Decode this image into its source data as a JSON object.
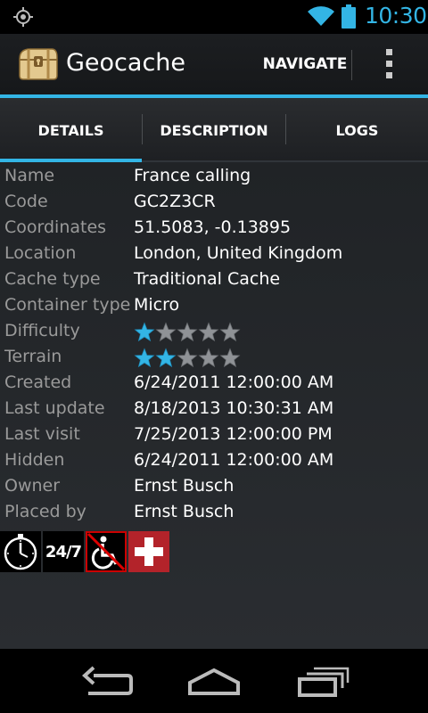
{
  "status_bar": {
    "time": "10:30",
    "icons": [
      "gps-icon",
      "wifi-icon",
      "battery-icon"
    ],
    "accent_color": "#33b5e5"
  },
  "action_bar": {
    "title": "Geocache",
    "navigate_label": "NAVIGATE",
    "logo_icon": "treasure-chest-icon",
    "overflow_icon": "overflow-menu-icon"
  },
  "tabs": [
    {
      "label": "DETAILS",
      "selected": true
    },
    {
      "label": "DESCRIPTION",
      "selected": false
    },
    {
      "label": "LOGS",
      "selected": false
    }
  ],
  "details": [
    {
      "label": "Name",
      "value": "France calling"
    },
    {
      "label": "Code",
      "value": "GC2Z3CR"
    },
    {
      "label": "Coordinates",
      "value": "51.5083, -0.13895"
    },
    {
      "label": "Location",
      "value": "London, United Kingdom"
    },
    {
      "label": "Cache type",
      "value": "Traditional Cache"
    },
    {
      "label": "Container type",
      "value": "Micro"
    },
    {
      "label": "Difficulty",
      "stars": 1,
      "max_stars": 5
    },
    {
      "label": "Terrain",
      "stars": 2,
      "max_stars": 5
    },
    {
      "label": "Created",
      "value": "6/24/2011 12:00:00 AM"
    },
    {
      "label": "Last update",
      "value": "8/18/2013 10:30:31 AM"
    },
    {
      "label": "Last visit",
      "value": "7/25/2013 12:00:00 PM"
    },
    {
      "label": "Hidden",
      "value": "6/24/2011 12:00:00 AM"
    },
    {
      "label": "Owner",
      "value": "Ernst Busch"
    },
    {
      "label": "Placed by",
      "value": "Ernst Busch"
    }
  ],
  "attributes": {
    "icons": [
      "stopwatch-icon",
      "open-24-7-icon",
      "no-wheelchair-icon",
      "first-aid-icon"
    ],
    "open_label": "24/7"
  },
  "nav_bar": {
    "icons": [
      "back-icon",
      "home-icon",
      "recent-apps-icon"
    ]
  }
}
